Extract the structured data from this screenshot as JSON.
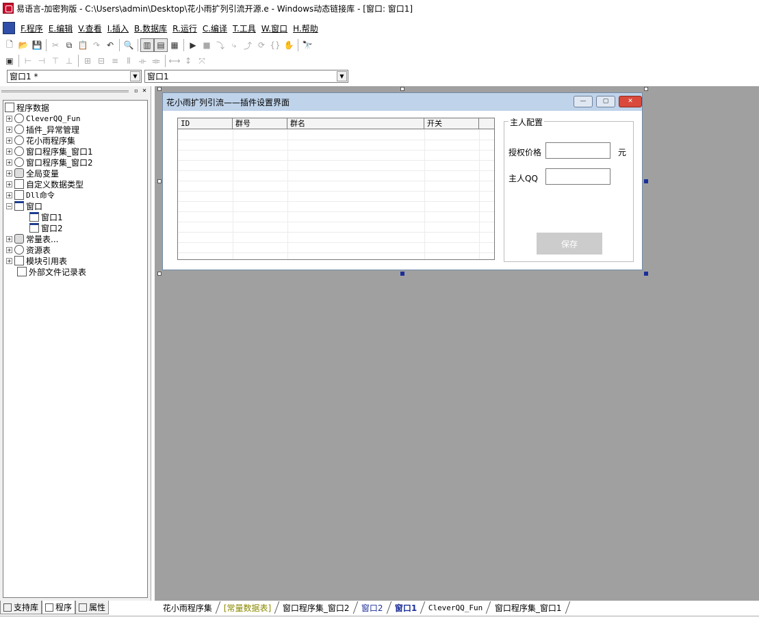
{
  "window": {
    "title": "易语言-加密狗版 - C:\\Users\\admin\\Desktop\\花小雨扩列引流开源.e - Windows动态链接库 - [窗口: 窗口1]"
  },
  "menu": [
    "F.程序",
    "E.编辑",
    "V.查看",
    "I.插入",
    "B.数据库",
    "R.运行",
    "C.编译",
    "T.工具",
    "W.窗口",
    "H.帮助"
  ],
  "toolbar": {
    "row1": [
      "new-file-icon",
      "open-folder-icon",
      "save-icon",
      "cut-icon",
      "copy-icon",
      "paste-icon",
      "redo-icon",
      "undo-icon",
      "find-icon",
      "layout-left-icon",
      "layout-top-icon",
      "layout-split-icon",
      "run-icon",
      "stop-icon",
      "step-icon",
      "step-into-icon",
      "step-out-icon",
      "step-over-icon",
      "breakpoint-icon",
      "hand-icon",
      "binoculars-icon"
    ],
    "row2": [
      "form-icon",
      "align-left-icon",
      "align-right-icon",
      "align-top-icon",
      "align-bottom-icon",
      "center-h-icon",
      "center-v-icon",
      "same-width-icon",
      "same-height-icon",
      "space-h-icon",
      "space-v-icon",
      "size-w-icon",
      "size-h-icon",
      "size-both-icon"
    ]
  },
  "combos": {
    "left": "窗口1 *",
    "right": "窗口1"
  },
  "tree": {
    "root": "程序数据",
    "items": [
      "CleverQQ_Fun",
      "插件_异常管理",
      "花小雨程序集",
      "窗口程序集_窗口1",
      "窗口程序集_窗口2",
      "全局变量",
      "自定义数据类型",
      "Dll命令",
      "窗口",
      "窗口1",
      "窗口2",
      "常量表...",
      "资源表",
      "模块引用表",
      "外部文件记录表"
    ]
  },
  "left_tabs": [
    "支持库",
    "程序",
    "属性"
  ],
  "bottom_tabs": [
    "花小雨程序集",
    "[常量数据表]",
    "窗口程序集_窗口2",
    "窗口2",
    "窗口1",
    "CleverQQ_Fun",
    "窗口程序集_窗口1"
  ],
  "design": {
    "caption": "花小雨扩列引流——插件设置界面",
    "columns": [
      "ID",
      "群号",
      "群名",
      "开关"
    ],
    "group_title": "主人配置",
    "price_label": "授权价格",
    "price_unit": "元",
    "owner_label": "主人QQ",
    "save_label": "保存"
  }
}
